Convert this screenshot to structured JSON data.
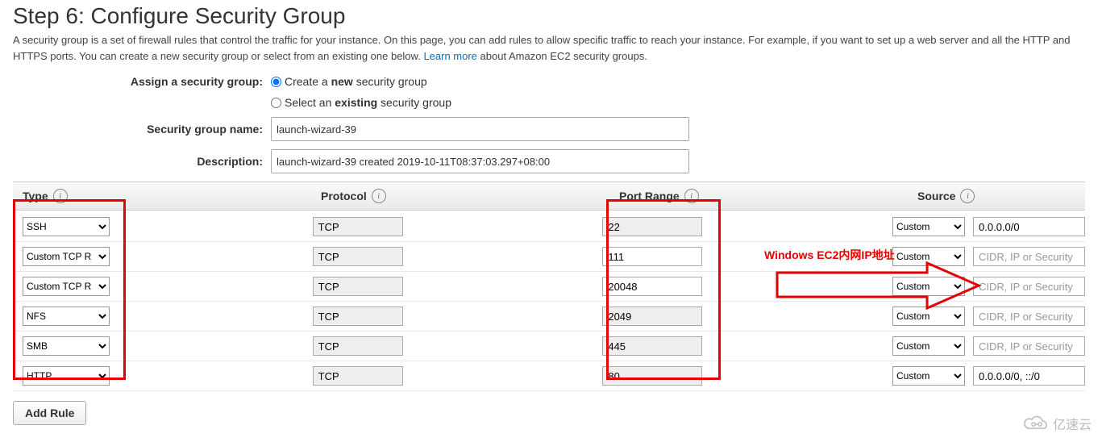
{
  "header": {
    "title": "Step 6: Configure Security Group",
    "desc_parts": {
      "before_link": "A security group is a set of firewall rules that control the traffic for your instance. On this page, you can add rules to allow specific traffic to reach your instance. For example, if you want to set up a web server and all the HTTP and HTTPS ports. You can create a new security group or select from an existing one below. ",
      "link": "Learn more",
      "after_link": " about Amazon EC2 security groups."
    }
  },
  "form": {
    "assign_label": "Assign a security group:",
    "radio_create_before": "Create a ",
    "radio_create_bold": "new",
    "radio_create_after": " security group",
    "radio_select_before": "Select an ",
    "radio_select_bold": "existing",
    "radio_select_after": " security group",
    "name_label": "Security group name:",
    "name_value": "launch-wizard-39",
    "desc_label": "Description:",
    "desc_value": "launch-wizard-39 created 2019-10-11T08:37:03.297+08:00"
  },
  "table": {
    "headers": {
      "type": "Type",
      "protocol": "Protocol",
      "port": "Port Range",
      "source": "Source"
    },
    "rows": [
      {
        "type": "SSH",
        "protocol": "TCP",
        "port": "22",
        "port_locked": true,
        "source_type": "Custom",
        "cidr": "0.0.0.0/0",
        "cidr_placeholder": ""
      },
      {
        "type": "Custom TCP R",
        "protocol": "TCP",
        "port": "111",
        "port_locked": false,
        "source_type": "Custom",
        "cidr": "",
        "cidr_placeholder": "CIDR, IP or Security"
      },
      {
        "type": "Custom TCP R",
        "protocol": "TCP",
        "port": "20048",
        "port_locked": false,
        "source_type": "Custom",
        "cidr": "",
        "cidr_placeholder": "CIDR, IP or Security"
      },
      {
        "type": "NFS",
        "protocol": "TCP",
        "port": "2049",
        "port_locked": true,
        "source_type": "Custom",
        "cidr": "",
        "cidr_placeholder": "CIDR, IP or Security"
      },
      {
        "type": "SMB",
        "protocol": "TCP",
        "port": "445",
        "port_locked": true,
        "source_type": "Custom",
        "cidr": "",
        "cidr_placeholder": "CIDR, IP or Security"
      },
      {
        "type": "HTTP",
        "protocol": "TCP",
        "port": "80",
        "port_locked": true,
        "source_type": "Custom",
        "cidr": "0.0.0.0/0, ::/0",
        "cidr_placeholder": ""
      }
    ]
  },
  "buttons": {
    "add_rule": "Add Rule"
  },
  "annotation": {
    "text": "Windows EC2内网IP地址"
  },
  "watermark": {
    "text": "亿速云"
  }
}
